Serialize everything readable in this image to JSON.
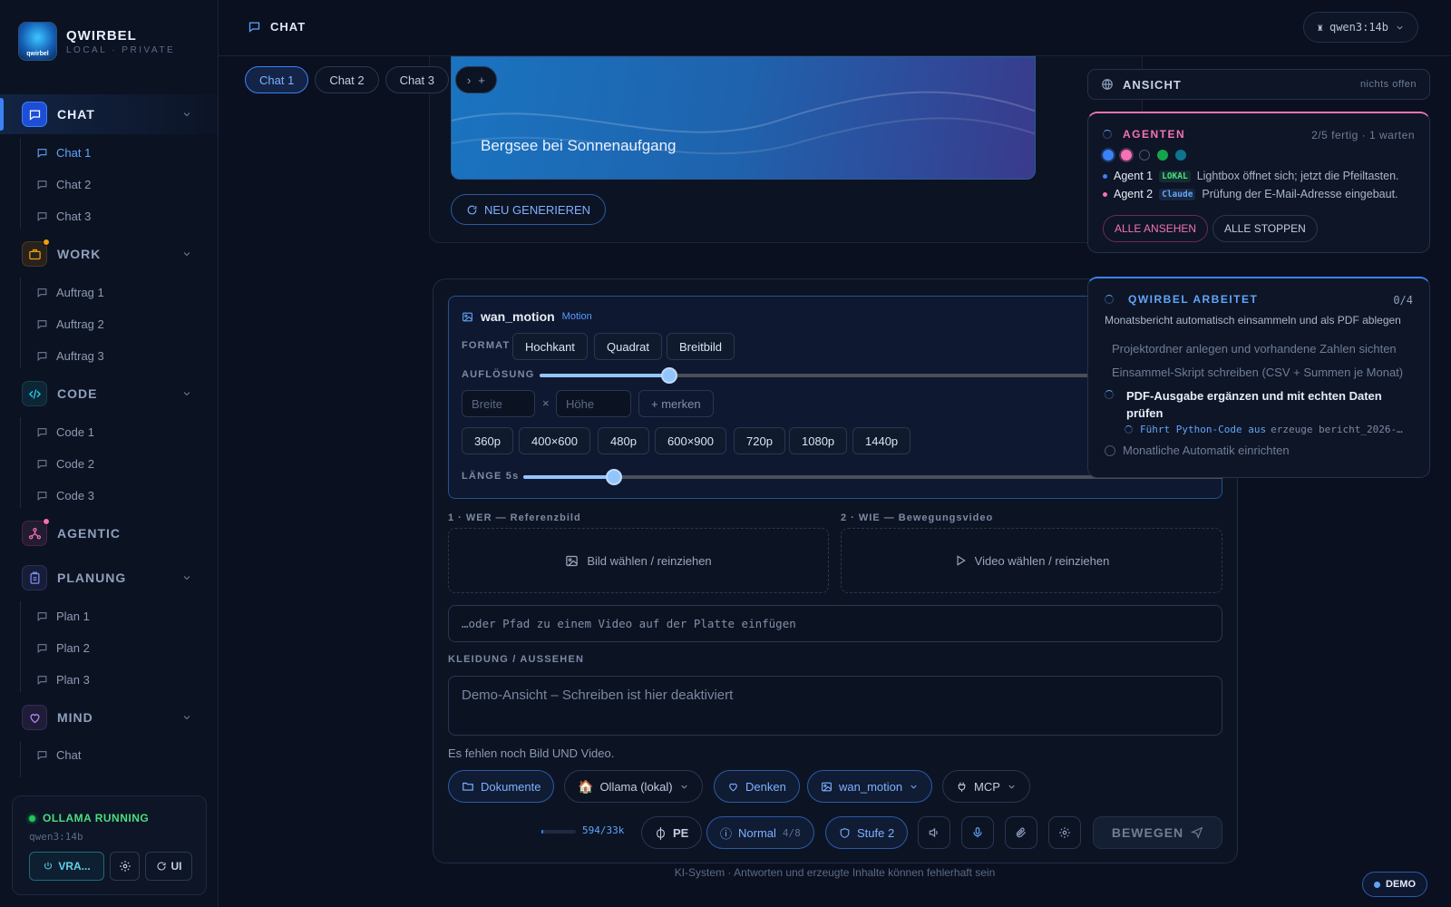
{
  "brand": {
    "name": "QWIRBEL",
    "sub": "LOCAL · PRIVATE",
    "logo_text": "qwirbel"
  },
  "sidebar": {
    "sections": [
      {
        "label": "CHAT",
        "items": [
          "Chat 1",
          "Chat 2",
          "Chat 3"
        ],
        "color": "#3b82f6"
      },
      {
        "label": "WORK",
        "items": [
          "Auftrag 1",
          "Auftrag 2",
          "Auftrag 3"
        ],
        "color": "#f59e0b"
      },
      {
        "label": "CODE",
        "items": [
          "Code 1",
          "Code 2",
          "Code 3"
        ],
        "color": "#22d3ee"
      },
      {
        "label": "AGENTIC",
        "items": [],
        "color": "#f472b6"
      },
      {
        "label": "PLANUNG",
        "items": [
          "Plan 1",
          "Plan 2",
          "Plan 3"
        ],
        "color": "#818cf8"
      },
      {
        "label": "MIND",
        "items": [
          "Chat"
        ],
        "color": "#c084fc"
      }
    ],
    "status": {
      "title": "OLLAMA RUNNING",
      "model": "qwen3:14b",
      "power_label": "VRA...",
      "refresh_label": "UI"
    }
  },
  "header": {
    "title": "CHAT",
    "model": "qwen3:14b"
  },
  "tabs": [
    "Chat 1",
    "Chat 2",
    "Chat 3"
  ],
  "message": {
    "caption": "Bergsee bei Sonnenaufgang",
    "regen_label": "NEU GENERIEREN"
  },
  "media": {
    "name": "wan_motion",
    "badge": "Motion",
    "format_label": "FORMAT",
    "formats": [
      "Hochkant",
      "Quadrat",
      "Breitbild"
    ],
    "resolution_label": "AUFLÖSUNG",
    "width_placeholder": "Breite",
    "height_placeholder": "Höhe",
    "times": "×",
    "remember_label": "+ merken",
    "presets": [
      "360p",
      "400×600",
      "480p",
      "600×900",
      "720p",
      "1080p",
      "1440p"
    ],
    "length_label": "LÄNGE 5s",
    "resolution_level": 0.19,
    "length_level": 0.13
  },
  "uploads": {
    "ref_label": "1 · WER — Referenzbild",
    "ref_button": "Bild wählen / reinziehen",
    "motion_label": "2 · WIE — Bewegungsvideo",
    "motion_button": "Video wählen / reinziehen",
    "path_placeholder": "…oder Pfad zu einem Video auf der Platte einfügen"
  },
  "clothing": {
    "label": "KLEIDUNG / AUSSEHEN",
    "placeholder": "Demo-Ansicht – Schreiben ist hier deaktiviert"
  },
  "warning": "Es fehlen noch Bild UND Video.",
  "toolbar": {
    "docs": "Dokumente",
    "provider": "Ollama (lokal)",
    "think": "Denken",
    "workflow": "wan_motion",
    "mcp": "MCP",
    "tokens": "594/33k",
    "pe": "PE",
    "mode": "Normal",
    "mode_count": "4/8",
    "level": "Stufe 2",
    "send": "BEWEGEN"
  },
  "footer": "KI-System · Antworten und erzeugte Inhalte können fehlerhaft sein",
  "demo_badge": "DEMO",
  "ansicht": {
    "title": "ANSICHT",
    "status": "nichts offen"
  },
  "agents": {
    "title": "AGENTEN",
    "meta": "2/5 fertig · 1 warten",
    "rows": [
      {
        "name": "Agent 1",
        "tag": "LOKAL",
        "text": "Lightbox öffnet sich; jetzt die Pfeiltasten."
      },
      {
        "name": "Agent 2",
        "tag": "Claude",
        "text": "Prüfung der E-Mail-Adresse eingebaut."
      }
    ],
    "view_all": "ALLE ANSEHEN",
    "stop_all": "ALLE STOPPEN"
  },
  "work": {
    "title": "QWIRBEL ARBEITET",
    "count": "0/4",
    "task": "Monatsbericht automatisch einsammeln und als PDF ablegen",
    "steps": [
      "Projektordner anlegen und vorhandene Zahlen sichten",
      "Einsammel-Skript schreiben (CSV + Summen je Monat)",
      "PDF-Ausgabe ergänzen und mit echten Daten prüfen",
      "Monatliche Automatik einrichten"
    ],
    "sub_action": "Führt Python-Code aus",
    "sub_file": "erzeuge bericht_2026-…"
  }
}
